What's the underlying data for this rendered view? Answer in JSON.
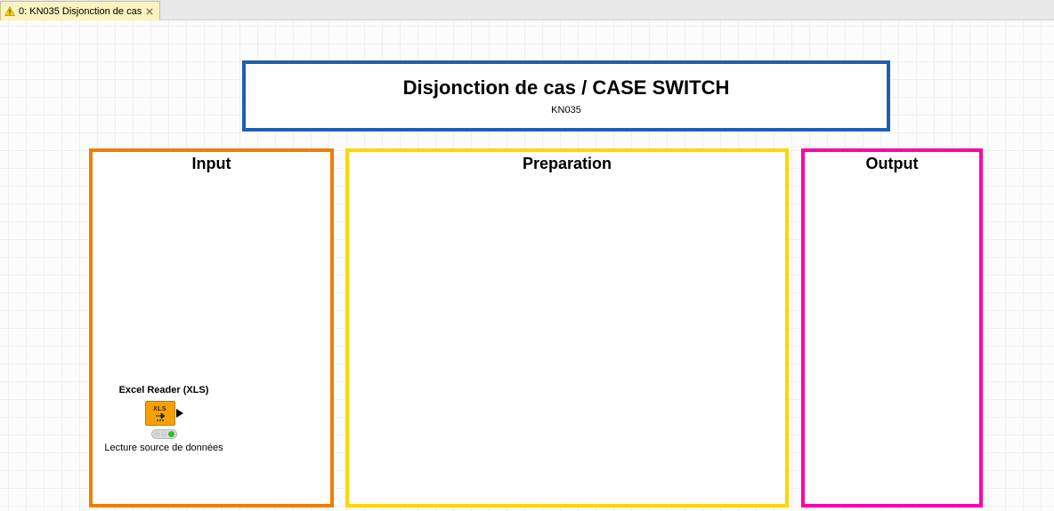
{
  "tab": {
    "label": "0: KN035 Disjonction de cas"
  },
  "titleBox": {
    "main": "Disjonction de cas / CASE SWITCH",
    "sub": "KN035"
  },
  "groups": {
    "input": {
      "label": "Input"
    },
    "preparation": {
      "label": "Preparation"
    },
    "output": {
      "label": "Output"
    }
  },
  "nodes": {
    "excelReader": {
      "title": "Excel Reader (XLS)",
      "badge": "XLS",
      "caption": "Lecture source de données"
    }
  }
}
